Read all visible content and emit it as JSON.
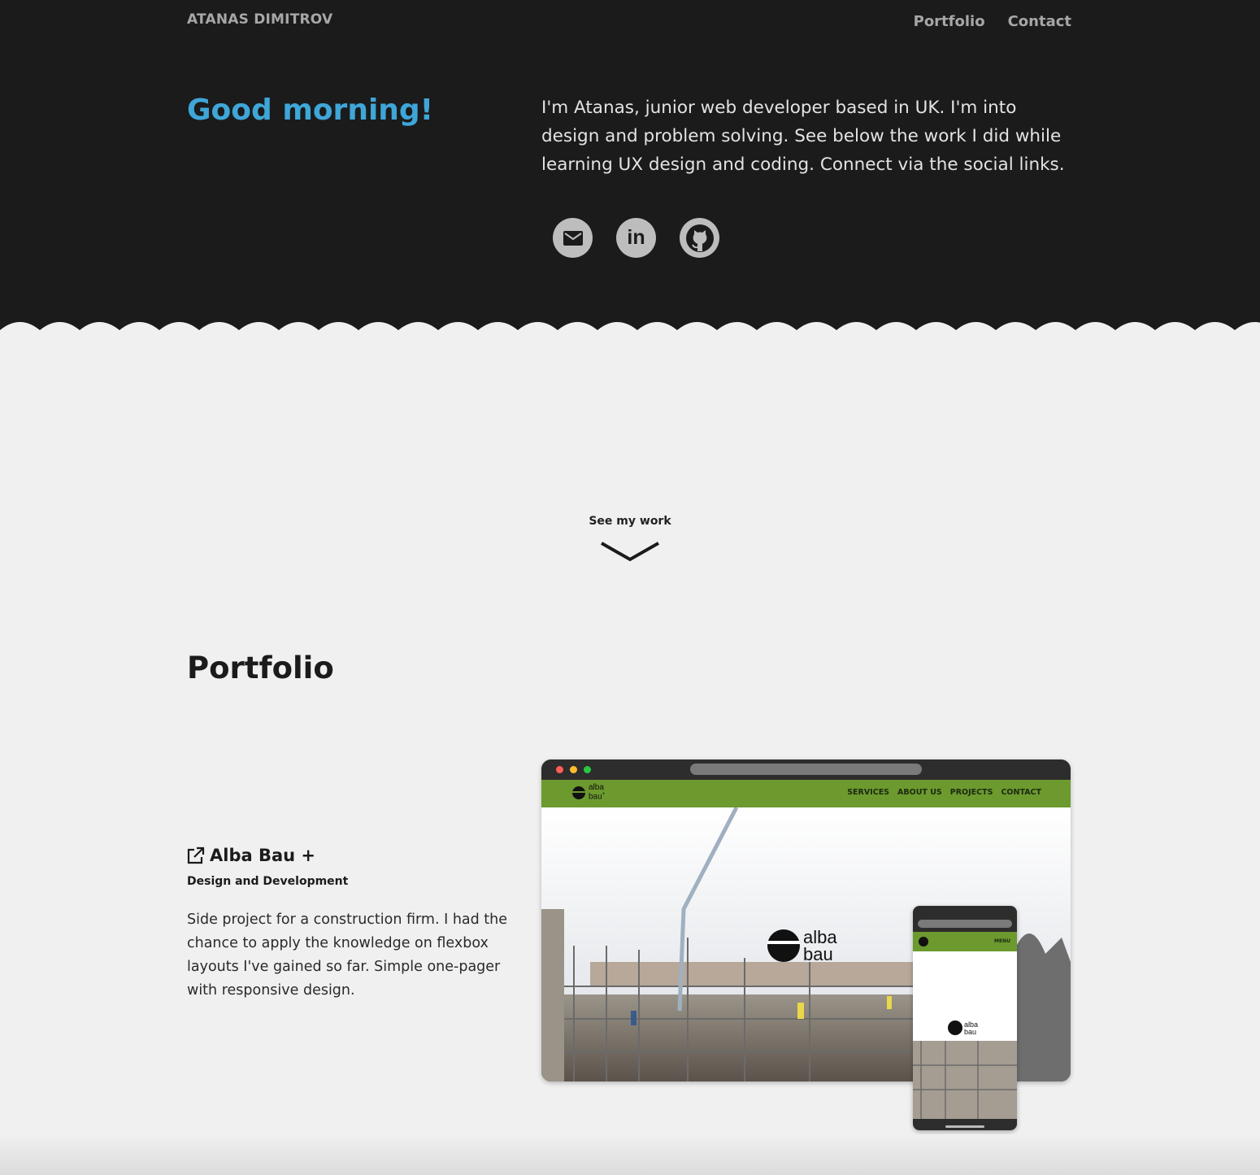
{
  "header": {
    "brand": "ATANAS DIMITROV",
    "nav": [
      {
        "label": "Portfolio"
      },
      {
        "label": "Contact"
      }
    ]
  },
  "hero": {
    "greeting": "Good morning!",
    "intro": "I'm Atanas, junior web developer based in UK. I'm into design and problem solving. See below the work I did while learning UX design and coding. Connect via the social links.",
    "socials": [
      {
        "icon": "email-icon"
      },
      {
        "icon": "linkedin-icon",
        "label": "in"
      },
      {
        "icon": "github-icon"
      }
    ],
    "accent_color": "#3fa6d8"
  },
  "scroll_cue": {
    "label": "See my work",
    "icon": "chevron-down-icon"
  },
  "portfolio": {
    "title": "Portfolio",
    "projects": [
      {
        "name": "Alba Bau +",
        "role": "Design and Development",
        "description": "Side project for a construction firm. I had the chance to apply the knowledge on flexbox layouts I've gained so far. Simple one-pager with responsive design.",
        "link_icon": "external-link-icon",
        "mockup": {
          "site_logo_line1": "alba",
          "site_logo_line2": "bau",
          "site_logo_sup": "+",
          "site_nav": [
            "SERVICES",
            "ABOUT US",
            "PROJECTS",
            "CONTACT"
          ],
          "phone_menu": "MENU",
          "brand_color": "#6c9a2e"
        }
      }
    ]
  }
}
